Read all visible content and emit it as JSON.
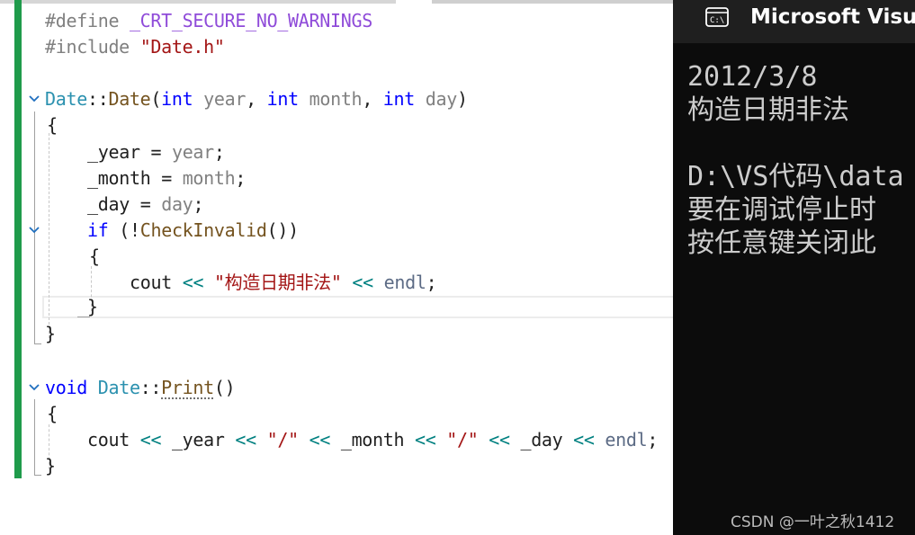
{
  "editor": {
    "lines": {
      "define": {
        "kw": "#define",
        "macro": "_CRT_SECURE_NO_WARNINGS"
      },
      "include": {
        "kw": "#include",
        "file": "\"Date.h\""
      },
      "ctor_sig": {
        "cls": "Date",
        "sep": "::",
        "fn": "Date",
        "open": "(",
        "t1": "int",
        "p1": "year",
        "c1": ", ",
        "t2": "int",
        "p2": "month",
        "c2": ", ",
        "t3": "int",
        "p3": "day",
        "close": ")"
      },
      "brace_open_1": "{",
      "year_assign": {
        "member": "_year",
        "eq": " = ",
        "param": "year",
        "semi": ";"
      },
      "month_assign": {
        "member": "_month",
        "eq": " = ",
        "param": "month",
        "semi": ";"
      },
      "day_assign": {
        "member": "_day",
        "eq": " = ",
        "param": "day",
        "semi": ";"
      },
      "if_line": {
        "kw": "if",
        "rest_open": " (!",
        "fn": "CheckInvalid",
        "rest_close": "())"
      },
      "brace_open_2": "{",
      "cout_msg": {
        "cout": "cout",
        "op1": " << ",
        "str": "\"构造日期非法\"",
        "op2": " << ",
        "endl": "endl",
        "semi": ";"
      },
      "brace_close_2": "}",
      "brace_close_1": "}",
      "print_sig": {
        "kw": "void",
        "cls": "Date",
        "sep": "::",
        "fn": "Print",
        "parens": "()"
      },
      "brace_open_3": "{",
      "cout_date": {
        "cout": "cout",
        "op1": " << ",
        "year": "_year",
        "op2": " << ",
        "s1": "\"/\"",
        "op3": " << ",
        "month": "_month",
        "op4": " << ",
        "s2": "\"/\"",
        "op5": " << ",
        "day": "_day",
        "op6": " << ",
        "endl": "endl",
        "semi": ";"
      },
      "brace_close_3": "}"
    }
  },
  "console": {
    "title": "Microsoft Visual Studio Debug Console",
    "output": [
      "2012/3/8",
      "构造日期非法",
      "",
      "D:\\VS代码\\data",
      "要在调试停止时",
      "按任意键关闭此"
    ],
    "icon": "terminal-icon"
  },
  "watermark": "CSDN @一叶之秋1412",
  "colors": {
    "change_bar": "#1f9b4b",
    "keyword": "#0000ff",
    "type": "#2b91af",
    "string": "#a31515",
    "macro": "#8f4bd9",
    "console_bg": "#0c0c0c"
  }
}
